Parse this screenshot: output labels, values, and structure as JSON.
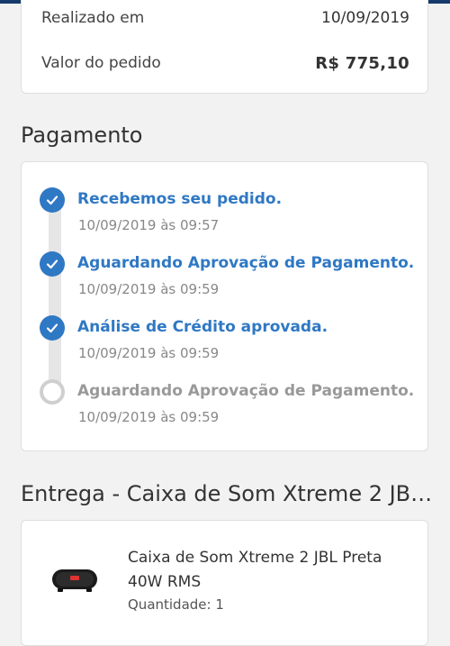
{
  "summary": {
    "date_label": "Realizado em",
    "date_value": "10/09/2019",
    "total_label": "Valor do pedido",
    "total_value": "R$ 775,10"
  },
  "payment": {
    "title": "Pagamento",
    "steps": [
      {
        "label": "Recebemos seu pedido.",
        "date": "10/09/2019 às 09:57",
        "status": "done"
      },
      {
        "label": "Aguardando Aprovação de Pagamento.",
        "date": "10/09/2019 às 09:59",
        "status": "done"
      },
      {
        "label": "Análise de Crédito aprovada.",
        "date": "10/09/2019 às 09:59",
        "status": "done"
      },
      {
        "label": "Aguardando Aprovação de Pagamento.",
        "date": "10/09/2019 às 09:59",
        "status": "pending"
      }
    ]
  },
  "delivery": {
    "title": "Entrega - Caixa de Som Xtreme 2 JB…",
    "product": {
      "name": "Caixa de Som Xtreme 2 JBL Preta 40W RMS",
      "quantity": "Quantidade: 1",
      "image_icon": "speaker-image"
    }
  },
  "colors": {
    "accent": "#2f78c4",
    "pending": "#999999",
    "header": "#153a6b"
  }
}
